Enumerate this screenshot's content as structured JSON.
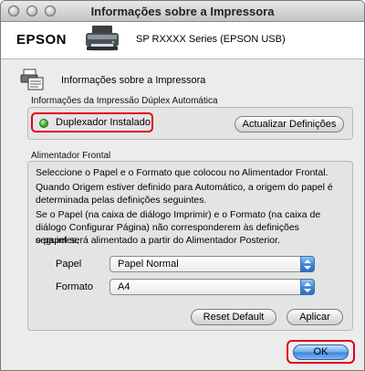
{
  "window": {
    "title": "Informações sobre a Impressora"
  },
  "header": {
    "brand": "EPSON",
    "model": "SP RXXXX Series (EPSON USB)"
  },
  "section": {
    "title": "Informações sobre a Impressora"
  },
  "duplex": {
    "group_label": "Informações da Impressão Dúplex Automática",
    "status_text": "Duplexador Instalado",
    "status_color": "#2a9a18",
    "update_button": "Actualizar Definições"
  },
  "front_feeder": {
    "group_label": "Alimentador Frontal",
    "desc_line1": "Seleccione o Papel e o Formato que colocou no Alimentador Frontal.",
    "desc_line2a": "Quando Origem estiver definido para Automático, a origem do papel é",
    "desc_line2b": "determinada pelas definições seguintes.",
    "desc_line3a": "Se o Papel (na caixa de diálogo Imprimir) e o Formato (na caixa de",
    "desc_line3b": "diálogo Configurar Página) não corresponderem às definições seguintes,",
    "desc_line3c": "o papel será alimentado a partir do Alimentador Posterior.",
    "paper_label": "Papel",
    "paper_value": "Papel Normal",
    "format_label": "Formato",
    "format_value": "A4",
    "reset_button": "Reset Default",
    "apply_button": "Aplicar"
  },
  "footer": {
    "ok_button": "OK"
  },
  "colors": {
    "highlight": "#e0001b",
    "accent": "#3b82dc"
  }
}
